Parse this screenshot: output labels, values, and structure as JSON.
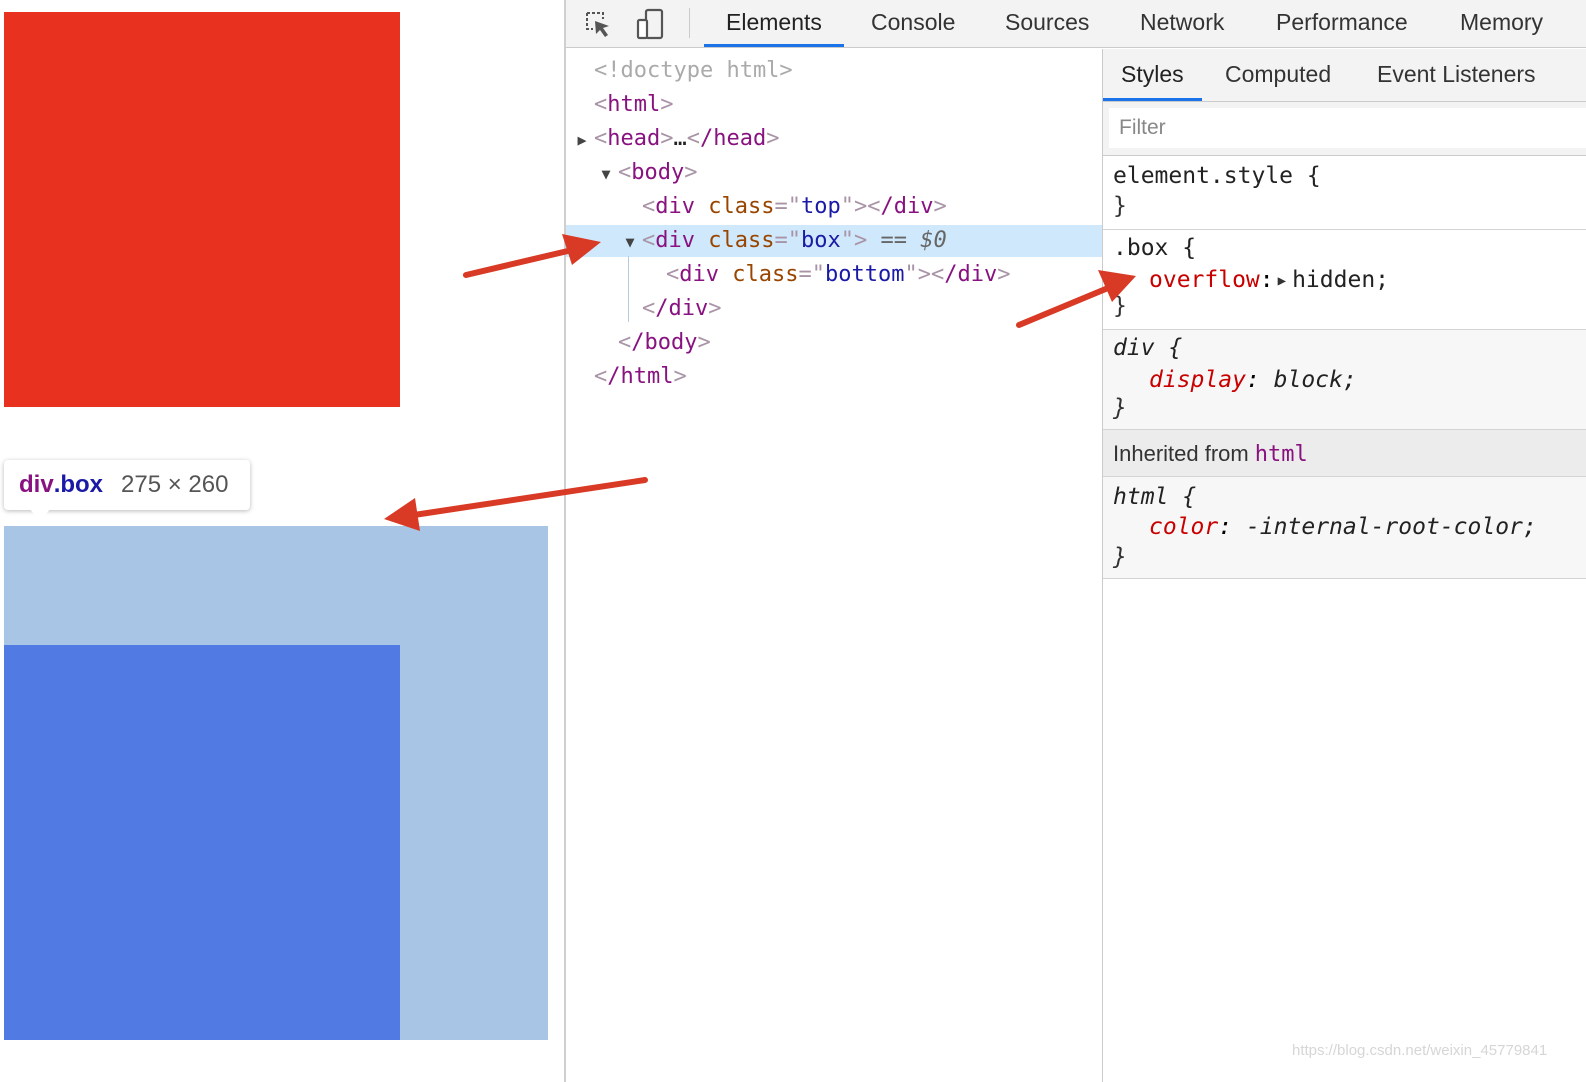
{
  "page": {
    "colors": {
      "top_box": "#e8321f",
      "box_highlight": "#a9c5e6",
      "bottom_box": "#527ae3"
    },
    "tooltip": {
      "tag": "div",
      "class": ".box",
      "size": "275 × 260"
    }
  },
  "devtools": {
    "toolbar": {
      "icons": [
        "inspect-element-icon",
        "device-toolbar-icon"
      ],
      "tabs": [
        "Elements",
        "Console",
        "Sources",
        "Network",
        "Performance",
        "Memory"
      ],
      "active_tab": "Elements"
    },
    "dom": {
      "doctype": "<!doctype html>",
      "html_open": "html",
      "head_open": "head",
      "head_ellipsis": "…",
      "head_close": "/head",
      "body_open": "body",
      "div_tag": "div",
      "div_close": "/div",
      "class_attr": "class",
      "top_class": "top",
      "box_class": "box",
      "bottom_class": "bottom",
      "selected_marker": "==",
      "selected_var": "$0",
      "body_close": "/body",
      "html_close": "/html"
    },
    "styles": {
      "subtabs": [
        "Styles",
        "Computed",
        "Event Listeners"
      ],
      "active_subtab": "Styles",
      "filter_placeholder": "Filter",
      "rules": {
        "element_style": {
          "selector": "element.style {",
          "close": "}"
        },
        "box": {
          "selector": ".box {",
          "property": "overflow",
          "value": "hidden;",
          "close": "}"
        },
        "div": {
          "selector": "div {",
          "property": "display",
          "value": "block;",
          "close": "}"
        },
        "html": {
          "selector": "html {",
          "property": "color",
          "value": "-internal-root-color;",
          "close": "}"
        }
      },
      "inherited_label": "Inherited from",
      "inherited_link": "html"
    }
  },
  "annotations": {
    "arrow_color": "#d93a25"
  },
  "watermark": "https://blog.csdn.net/weixin_45779841"
}
